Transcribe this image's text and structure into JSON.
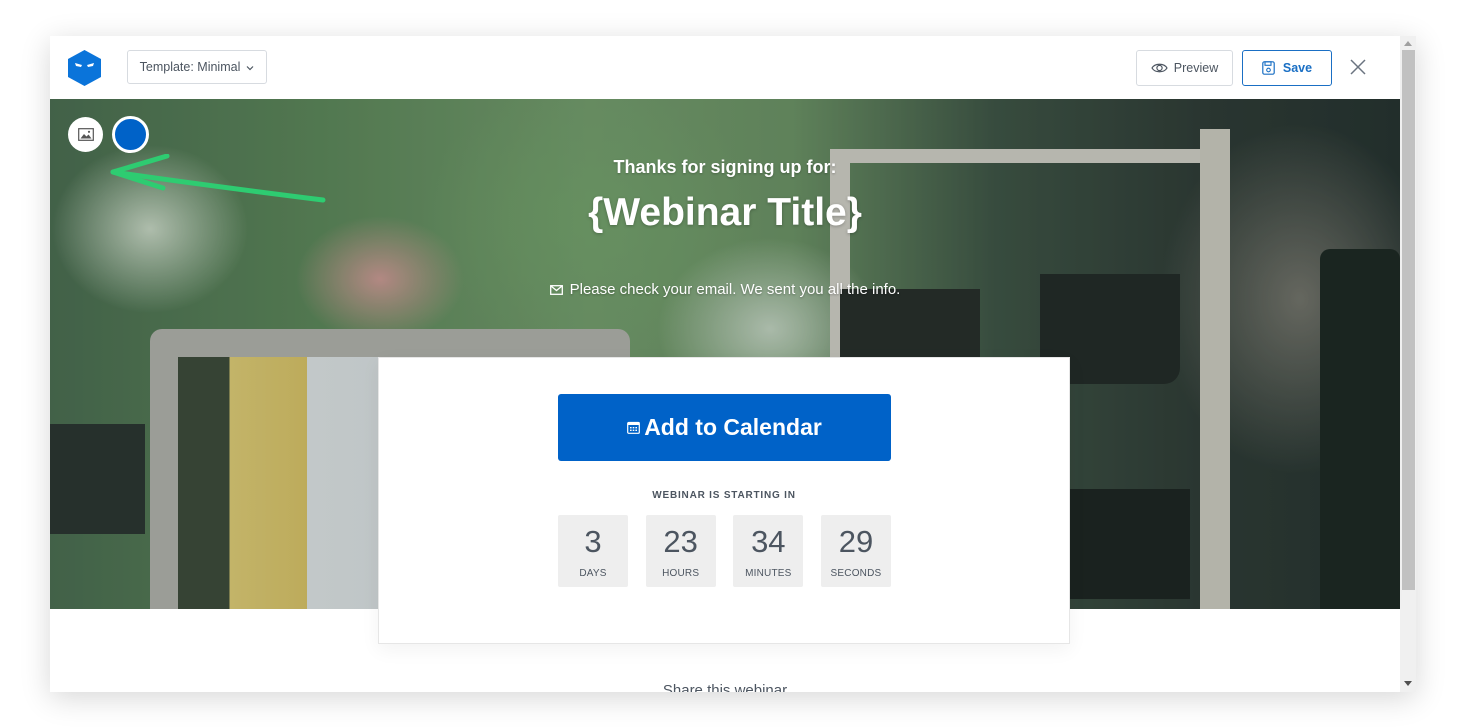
{
  "toolbar": {
    "template_label": "Template: Minimal",
    "template_chevron": "⌄",
    "preview_label": "Preview",
    "save_label": "Save",
    "brand_color": "#0a74da",
    "accent_color": "#1a6fc4"
  },
  "hero": {
    "subtitle": "Thanks for signing up for:",
    "title": "{Webinar Title}",
    "note": "Please check your email. We sent you all the info.",
    "background_color_swatch": "#0062c8",
    "annotation_color": "#2ecc71"
  },
  "card": {
    "calendar_button_label": "Add to Calendar",
    "calendar_button_color": "#0062c8",
    "countdown_label": "WEBINAR IS STARTING IN",
    "countdown": [
      {
        "value": "3",
        "unit": "DAYS"
      },
      {
        "value": "23",
        "unit": "HOURS"
      },
      {
        "value": "34",
        "unit": "MINUTES"
      },
      {
        "value": "29",
        "unit": "SECONDS"
      }
    ]
  },
  "footer": {
    "share_text": "Share this webinar"
  }
}
